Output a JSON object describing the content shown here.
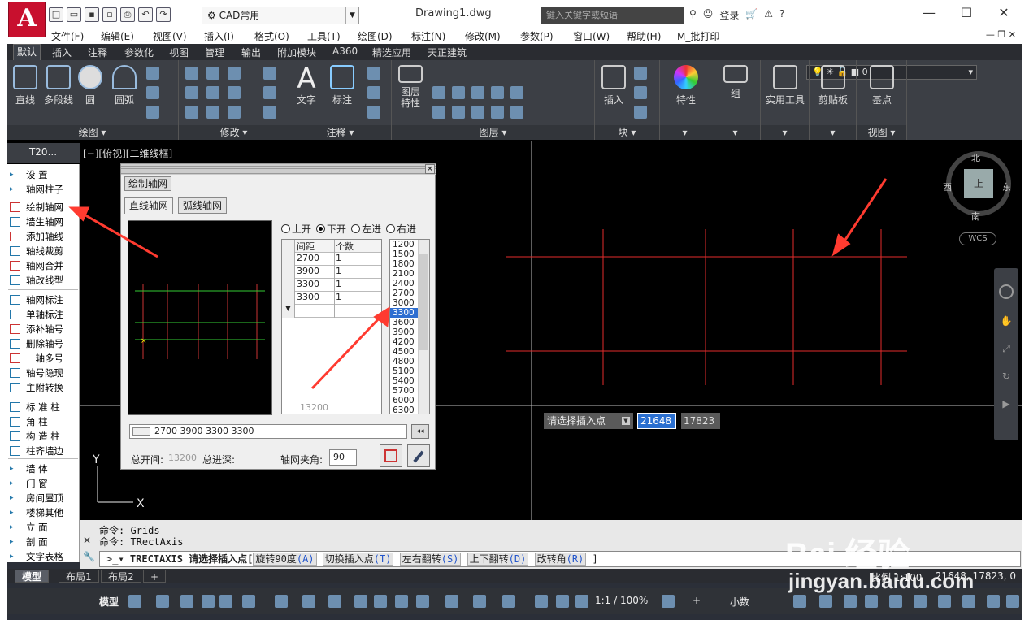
{
  "window": {
    "doc_title": "Drawing1.dwg",
    "workspace": "CAD常用",
    "search_placeholder": "键入关键字或短语",
    "login": "登录",
    "logo_letter": "A"
  },
  "menu": [
    "文件(F)",
    "编辑(E)",
    "视图(V)",
    "插入(I)",
    "格式(O)",
    "工具(T)",
    "绘图(D)",
    "标注(N)",
    "修改(M)",
    "参数(P)",
    "窗口(W)",
    "帮助(H)",
    "M_批打印"
  ],
  "tabs": [
    "默认",
    "插入",
    "注释",
    "参数化",
    "视图",
    "管理",
    "输出",
    "附加模块",
    "A360",
    "精选应用",
    "天正建筑"
  ],
  "ribbon": {
    "draw_buttons": [
      "直线",
      "多段线",
      "圆",
      "圆弧"
    ],
    "draw_title": "绘图",
    "modify_title": "修改",
    "annot_buttons": [
      "文字",
      "标注"
    ],
    "annot_title": "注释",
    "layer_button": "图层\n特性",
    "layer_value": "0",
    "layer_title": "图层",
    "block_button": "插入",
    "block_title": "块",
    "props_button": "特性",
    "group_button": "组",
    "util_button": "实用工具",
    "clip_button": "剪贴板",
    "base_button": "基点",
    "view_title": "视图"
  },
  "leftpanel": {
    "title": "T20...",
    "rows": [
      {
        "t": "设    置",
        "head": true
      },
      {
        "t": "轴网柱子",
        "head": true
      },
      {
        "t": "绘制轴网"
      },
      {
        "t": "墙生轴网"
      },
      {
        "t": "添加轴线"
      },
      {
        "t": "轴线裁剪"
      },
      {
        "t": "轴网合并"
      },
      {
        "t": "轴改线型"
      },
      {
        "t": "轴网标注"
      },
      {
        "t": "单轴标注"
      },
      {
        "t": "添补轴号"
      },
      {
        "t": "删除轴号"
      },
      {
        "t": "一轴多号"
      },
      {
        "t": "轴号隐现"
      },
      {
        "t": "主附转换"
      },
      {
        "t": "标 准 柱"
      },
      {
        "t": "角    柱"
      },
      {
        "t": "构 造 柱"
      },
      {
        "t": "柱齐墙边"
      },
      {
        "t": "墙    体",
        "head": true
      },
      {
        "t": "门    窗",
        "head": true
      },
      {
        "t": "房间屋顶",
        "head": true
      },
      {
        "t": "楼梯其他",
        "head": true
      },
      {
        "t": "立    面",
        "head": true
      },
      {
        "t": "剖    面",
        "head": true
      },
      {
        "t": "文字表格",
        "head": true
      }
    ]
  },
  "viewport": {
    "label": "[−][俯视][二维线框]",
    "compass": {
      "n": "北",
      "s": "南",
      "e": "东",
      "w": "西",
      "center": "上"
    },
    "wcs": "WCS"
  },
  "dialog": {
    "title": "绘制轴网",
    "tabs": [
      "直线轴网",
      "弧线轴网"
    ],
    "radios": [
      {
        "label": "上开",
        "on": false
      },
      {
        "label": "下开",
        "on": true
      },
      {
        "label": "左进",
        "on": false
      },
      {
        "label": "右进",
        "on": false
      }
    ],
    "table_headers": [
      "间距",
      "个数"
    ],
    "rows": [
      [
        "2700",
        "1"
      ],
      [
        "3900",
        "1"
      ],
      [
        "3300",
        "1"
      ],
      [
        "3300",
        "1"
      ]
    ],
    "table_total": "13200",
    "values": [
      "1200",
      "1500",
      "1800",
      "2100",
      "2400",
      "2700",
      "3000",
      "3300",
      "3600",
      "3900",
      "4200",
      "4500",
      "4800",
      "5100",
      "5400",
      "5700",
      "6000",
      "6300"
    ],
    "selected_value": "3300",
    "input": "2700  3900  3300  3300",
    "total_open_label": "总开间:",
    "total_open": "13200",
    "total_depth_label": "总进深:",
    "angle_label": "轴网夹角:",
    "angle": "90"
  },
  "prompt": {
    "text": "请选择插入点",
    "x": "21648",
    "y": "17823"
  },
  "command": {
    "log": [
      "命令: Grids",
      "命令: TRectAxis"
    ],
    "current": "TRECTAXIS 请选择插入点[",
    "options": [
      {
        "t": "旋转90度",
        "k": "(A)"
      },
      {
        "t": "切换插入点",
        "k": "(T)"
      },
      {
        "t": "左右翻转",
        "k": "(S)"
      },
      {
        "t": "上下翻转",
        "k": "(D)"
      },
      {
        "t": "改转角",
        "k": "(R)"
      }
    ],
    "tail": "]"
  },
  "layout_tabs": [
    "模型",
    "布局1",
    "布局2",
    "+"
  ],
  "scale_label": "比例 1:100",
  "coords": "21648, 17823, 0",
  "status": {
    "model": "模型",
    "zoom": "1:1 / 100%",
    "units": "小数"
  },
  "watermark": {
    "brand": "Bai 经验",
    "url": "jingyan.baidu.com"
  },
  "colors": {
    "accent": "#c8102e",
    "grid_red": "#e32b2b",
    "select_blue": "#2e6ed0",
    "arrow": "#ff3b30"
  }
}
